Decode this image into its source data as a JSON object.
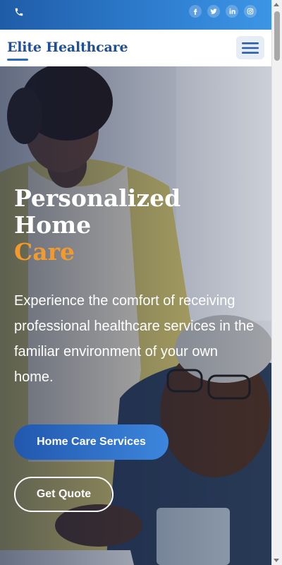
{
  "topbar": {
    "icons": [
      "phone-icon",
      "facebook-icon",
      "twitter-icon",
      "linkedin-icon",
      "instagram-icon"
    ]
  },
  "header": {
    "brand": "Elite Healthcare",
    "menu_icon": "hamburger-menu-icon"
  },
  "hero": {
    "title_line1": "Personalized",
    "title_line2": "Home",
    "title_accent": "Care",
    "description": "Experience the comfort of receiving professional healthcare services in the familiar environment of your own home.",
    "primary_button": "Home Care Services",
    "secondary_button": "Get Quote"
  },
  "colors": {
    "brand": "#1f4f94",
    "accent": "#f29a2e",
    "primary": "#2a6bbd"
  }
}
